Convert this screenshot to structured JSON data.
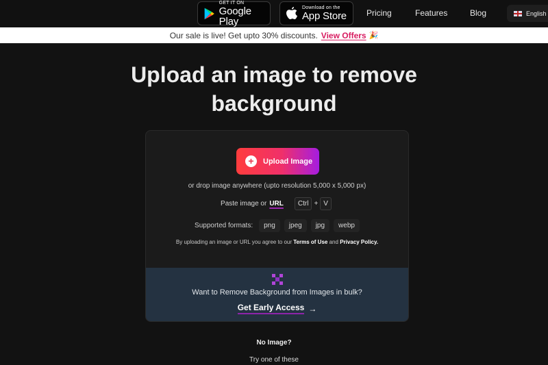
{
  "header": {
    "google_play": {
      "small": "GET IT ON",
      "big": "Google Play"
    },
    "app_store": {
      "small": "Download on the",
      "big": "App Store"
    },
    "nav": [
      "Pricing",
      "Features",
      "Blog"
    ],
    "language": "English"
  },
  "banner": {
    "text": "Our sale is live! Get upto 30% discounts.",
    "link": "View Offers",
    "emoji": "🎉"
  },
  "main": {
    "title": "Upload an image to remove background",
    "upload_button": "Upload Image",
    "drop_text": "or drop image anywhere (upto resolution 5,000 x 5,000 px)",
    "paste_label": "Paste image or",
    "url_link": "URL",
    "shortcut": {
      "key1": "Ctrl",
      "plus": "+",
      "key2": "V"
    },
    "formats_label": "Supported formats:",
    "formats": [
      "png",
      "jpeg",
      "jpg",
      "webp"
    ],
    "terms": {
      "prefix": "By uploading an image or URL you agree to our",
      "terms_link": "Terms of Use",
      "and": "and",
      "privacy_link": "Privacy Policy",
      "suffix": "."
    },
    "bulk": {
      "text": "Want to Remove Background from Images in bulk?",
      "cta": "Get Early Access",
      "arrow": "→"
    }
  },
  "samples": {
    "heading": "No Image?",
    "subheading": "Try one of these"
  },
  "colors": {
    "accent_pink": "#d81b60",
    "accent_purple": "#8e24aa",
    "bulk_bg": "#243241"
  }
}
